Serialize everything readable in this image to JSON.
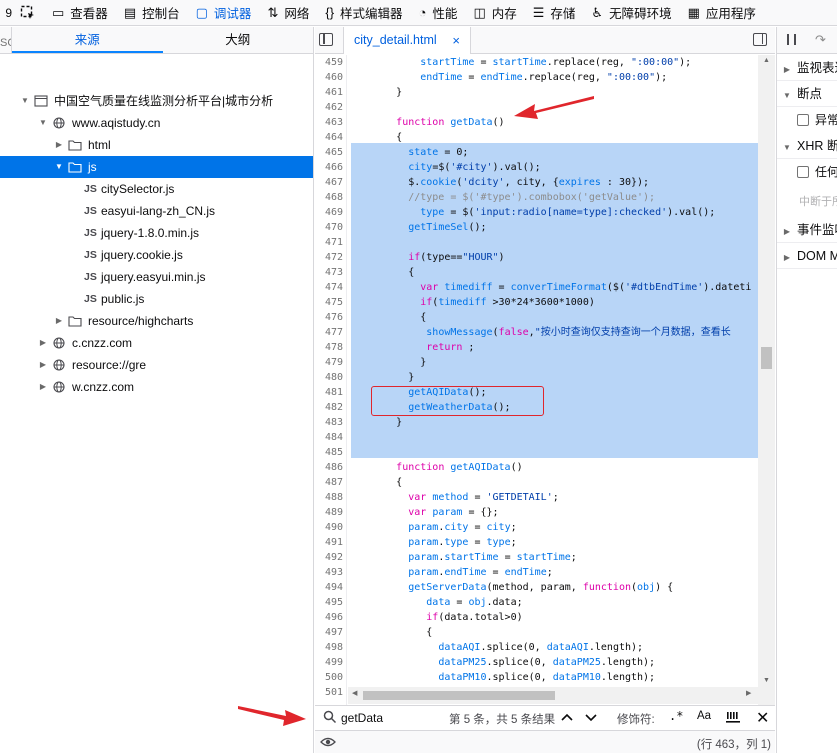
{
  "toolbar": {
    "stub": "9",
    "tabs": [
      {
        "label": "查看器",
        "icon": "inspector-icon"
      },
      {
        "label": "控制台",
        "icon": "console-icon"
      },
      {
        "label": "调试器",
        "icon": "debugger-icon",
        "active": true
      },
      {
        "label": "网络",
        "icon": "network-icon"
      },
      {
        "label": "样式编辑器",
        "icon": "style-editor-icon"
      },
      {
        "label": "性能",
        "icon": "performance-icon"
      },
      {
        "label": "内存",
        "icon": "memory-icon"
      },
      {
        "label": "存储",
        "icon": "storage-icon"
      },
      {
        "label": "无障碍环境",
        "icon": "accessibility-icon"
      },
      {
        "label": "应用程序",
        "icon": "application-icon"
      }
    ]
  },
  "sources": {
    "stub": "SC",
    "tab_sources": "来源",
    "tab_outline": "大纲",
    "tree": [
      {
        "label": "中国空气质量在线监测分析平台|城市分析",
        "kind": "page",
        "level": 0,
        "open": true
      },
      {
        "label": "www.aqistudy.cn",
        "kind": "globe",
        "level": 1,
        "open": true
      },
      {
        "label": "html",
        "kind": "folder",
        "level": 2,
        "open": false
      },
      {
        "label": "js",
        "kind": "folder",
        "level": 2,
        "open": true,
        "selected": true
      },
      {
        "label": "citySelector.js",
        "kind": "js",
        "level": 3
      },
      {
        "label": "easyui-lang-zh_CN.js",
        "kind": "js",
        "level": 3
      },
      {
        "label": "jquery-1.8.0.min.js",
        "kind": "js",
        "level": 3
      },
      {
        "label": "jquery.cookie.js",
        "kind": "js",
        "level": 3
      },
      {
        "label": "jquery.easyui.min.js",
        "kind": "js",
        "level": 3
      },
      {
        "label": "public.js",
        "kind": "js",
        "level": 3
      },
      {
        "label": "resource/highcharts",
        "kind": "folder",
        "level": 2,
        "open": false
      },
      {
        "label": "c.cnzz.com",
        "kind": "globe",
        "level": 1,
        "open": false
      },
      {
        "label": "resource://gre",
        "kind": "globe",
        "level": 1,
        "open": false
      },
      {
        "label": "w.cnzz.com",
        "kind": "globe",
        "level": 1,
        "open": false
      }
    ]
  },
  "editor": {
    "file_tab": "city_detail.html",
    "close_symbol": "×",
    "lines": [
      {
        "n": "459",
        "segs": [
          [
            "            ",
            ""
          ],
          [
            "startTime",
            "va"
          ],
          [
            " = ",
            ""
          ],
          [
            "startTime",
            "va"
          ],
          [
            ".replace(reg, ",
            ""
          ],
          [
            "\":00:00\"",
            "st"
          ],
          [
            ");",
            ""
          ]
        ]
      },
      {
        "n": "460",
        "segs": [
          [
            "            ",
            ""
          ],
          [
            "endTime",
            "va"
          ],
          [
            " = ",
            ""
          ],
          [
            "endTime",
            "va"
          ],
          [
            ".replace(reg, ",
            ""
          ],
          [
            "\":00:00\"",
            "st"
          ],
          [
            ");",
            ""
          ]
        ]
      },
      {
        "n": "461",
        "segs": [
          [
            "        }",
            ""
          ]
        ]
      },
      {
        "n": "462",
        "segs": []
      },
      {
        "n": "463",
        "segs": [
          [
            "        ",
            ""
          ],
          [
            "function",
            "kw"
          ],
          [
            " ",
            ""
          ],
          [
            "getData",
            "fn"
          ],
          [
            "()",
            ""
          ]
        ]
      },
      {
        "n": "464",
        "segs": [
          [
            "        {",
            ""
          ]
        ]
      },
      {
        "n": "465",
        "segs": [
          [
            "          ",
            ""
          ],
          [
            "state",
            "va"
          ],
          [
            " = 0;",
            ""
          ]
        ]
      },
      {
        "n": "466",
        "segs": [
          [
            "          ",
            ""
          ],
          [
            "city",
            "va"
          ],
          [
            "=$(",
            ""
          ],
          [
            "'#city'",
            "st"
          ],
          [
            ").val();",
            ""
          ]
        ]
      },
      {
        "n": "467",
        "segs": [
          [
            "          $.",
            ""
          ],
          [
            "cookie",
            "va"
          ],
          [
            "(",
            ""
          ],
          [
            "'dcity'",
            "st"
          ],
          [
            ", city, {",
            ""
          ],
          [
            "expires",
            "va"
          ],
          [
            " : 30});",
            ""
          ]
        ]
      },
      {
        "n": "468",
        "segs": [
          [
            "          //type = $('#type').combobox('getValue');",
            "cm"
          ]
        ]
      },
      {
        "n": "469",
        "segs": [
          [
            "            ",
            ""
          ],
          [
            "type",
            "va"
          ],
          [
            " = $(",
            ""
          ],
          [
            "'input:radio[name=type]:checked'",
            "st"
          ],
          [
            ").val();",
            ""
          ]
        ]
      },
      {
        "n": "470",
        "segs": [
          [
            "          ",
            ""
          ],
          [
            "getTimeSel",
            "va"
          ],
          [
            "();",
            ""
          ]
        ]
      },
      {
        "n": "471",
        "segs": []
      },
      {
        "n": "472",
        "segs": [
          [
            "          ",
            ""
          ],
          [
            "if",
            "kw"
          ],
          [
            "(type==",
            ""
          ],
          [
            "\"HOUR\"",
            "st"
          ],
          [
            ")",
            ""
          ]
        ]
      },
      {
        "n": "473",
        "segs": [
          [
            "          {",
            ""
          ]
        ]
      },
      {
        "n": "474",
        "segs": [
          [
            "            ",
            ""
          ],
          [
            "var",
            "kw"
          ],
          [
            " ",
            ""
          ],
          [
            "timediff",
            "va"
          ],
          [
            " = ",
            ""
          ],
          [
            "converTimeFormat",
            "va"
          ],
          [
            "($(",
            ""
          ],
          [
            "'#dtbEndTime'",
            "st"
          ],
          [
            ").dateti",
            ""
          ]
        ]
      },
      {
        "n": "475",
        "segs": [
          [
            "            ",
            ""
          ],
          [
            "if",
            "kw"
          ],
          [
            "(",
            ""
          ],
          [
            "timediff",
            "va"
          ],
          [
            " >30*24*3600*1000)",
            ""
          ]
        ]
      },
      {
        "n": "476",
        "segs": [
          [
            "            {",
            ""
          ]
        ]
      },
      {
        "n": "477",
        "segs": [
          [
            "             ",
            ""
          ],
          [
            "showMessage",
            "va"
          ],
          [
            "(",
            ""
          ],
          [
            "false",
            "kw"
          ],
          [
            ",",
            ""
          ],
          [
            "\"按小时查询仅支持查询一个月数据，查看长",
            "st"
          ]
        ]
      },
      {
        "n": "478",
        "segs": [
          [
            "             ",
            ""
          ],
          [
            "return",
            "kw"
          ],
          [
            " ;",
            ""
          ]
        ]
      },
      {
        "n": "479",
        "segs": [
          [
            "            }",
            ""
          ]
        ]
      },
      {
        "n": "480",
        "segs": [
          [
            "          }",
            ""
          ]
        ]
      },
      {
        "n": "481",
        "segs": [
          [
            "          ",
            ""
          ],
          [
            "getAQIData",
            "va"
          ],
          [
            "();",
            ""
          ]
        ]
      },
      {
        "n": "482",
        "segs": [
          [
            "          ",
            ""
          ],
          [
            "getWeatherData",
            "va"
          ],
          [
            "();",
            ""
          ]
        ]
      },
      {
        "n": "483",
        "segs": [
          [
            "        }",
            ""
          ]
        ]
      },
      {
        "n": "484",
        "segs": []
      },
      {
        "n": "485",
        "segs": []
      },
      {
        "n": "486",
        "segs": [
          [
            "        ",
            ""
          ],
          [
            "function",
            "kw"
          ],
          [
            " ",
            ""
          ],
          [
            "getAQIData",
            "va"
          ],
          [
            "()",
            ""
          ]
        ]
      },
      {
        "n": "487",
        "segs": [
          [
            "        {",
            ""
          ]
        ]
      },
      {
        "n": "488",
        "segs": [
          [
            "          ",
            ""
          ],
          [
            "var",
            "kw"
          ],
          [
            " ",
            ""
          ],
          [
            "method",
            "va"
          ],
          [
            " = ",
            ""
          ],
          [
            "'GETDETAIL'",
            "st"
          ],
          [
            ";",
            ""
          ]
        ]
      },
      {
        "n": "489",
        "segs": [
          [
            "          ",
            ""
          ],
          [
            "var",
            "kw"
          ],
          [
            " ",
            ""
          ],
          [
            "param",
            "va"
          ],
          [
            " = {};",
            ""
          ]
        ]
      },
      {
        "n": "490",
        "segs": [
          [
            "          ",
            ""
          ],
          [
            "param",
            "va"
          ],
          [
            ".",
            ""
          ],
          [
            "city",
            "va"
          ],
          [
            " = ",
            ""
          ],
          [
            "city",
            "va"
          ],
          [
            ";",
            ""
          ]
        ]
      },
      {
        "n": "491",
        "segs": [
          [
            "          ",
            ""
          ],
          [
            "param",
            "va"
          ],
          [
            ".",
            ""
          ],
          [
            "type",
            "va"
          ],
          [
            " = ",
            ""
          ],
          [
            "type",
            "va"
          ],
          [
            ";",
            ""
          ]
        ]
      },
      {
        "n": "492",
        "segs": [
          [
            "          ",
            ""
          ],
          [
            "param",
            "va"
          ],
          [
            ".",
            ""
          ],
          [
            "startTime",
            "va"
          ],
          [
            " = ",
            ""
          ],
          [
            "startTime",
            "va"
          ],
          [
            ";",
            ""
          ]
        ]
      },
      {
        "n": "493",
        "segs": [
          [
            "          ",
            ""
          ],
          [
            "param",
            "va"
          ],
          [
            ".",
            ""
          ],
          [
            "endTime",
            "va"
          ],
          [
            " = ",
            ""
          ],
          [
            "endTime",
            "va"
          ],
          [
            ";",
            ""
          ]
        ]
      },
      {
        "n": "494",
        "segs": [
          [
            "          ",
            ""
          ],
          [
            "getServerData",
            "va"
          ],
          [
            "(method, param, ",
            ""
          ],
          [
            "function",
            "kw"
          ],
          [
            "(",
            ""
          ],
          [
            "obj",
            "va"
          ],
          [
            ") {",
            ""
          ]
        ]
      },
      {
        "n": "495",
        "segs": [
          [
            "             ",
            ""
          ],
          [
            "data",
            "va"
          ],
          [
            " = ",
            ""
          ],
          [
            "obj",
            "va"
          ],
          [
            ".data;",
            ""
          ]
        ]
      },
      {
        "n": "496",
        "segs": [
          [
            "             ",
            ""
          ],
          [
            "if",
            "kw"
          ],
          [
            "(data.total>0)",
            ""
          ]
        ]
      },
      {
        "n": "497",
        "segs": [
          [
            "             {",
            ""
          ]
        ]
      },
      {
        "n": "498",
        "segs": [
          [
            "               ",
            ""
          ],
          [
            "dataAQI",
            "va"
          ],
          [
            ".splice(0, ",
            ""
          ],
          [
            "dataAQI",
            "va"
          ],
          [
            ".length);",
            ""
          ]
        ]
      },
      {
        "n": "499",
        "segs": [
          [
            "               ",
            ""
          ],
          [
            "dataPM25",
            "va"
          ],
          [
            ".splice(0, ",
            ""
          ],
          [
            "dataPM25",
            "va"
          ],
          [
            ".length);",
            ""
          ]
        ]
      },
      {
        "n": "500",
        "segs": [
          [
            "               ",
            ""
          ],
          [
            "dataPM10",
            "va"
          ],
          [
            ".splice(0, ",
            ""
          ],
          [
            "dataPM10",
            "va"
          ],
          [
            ".length);",
            ""
          ]
        ]
      },
      {
        "n": "501",
        "segs": []
      }
    ]
  },
  "search": {
    "query": "getData",
    "result_text": "第 5 条，共 5 条结果",
    "modifiers_label": "修饰符:",
    "regex_label": ".*",
    "case_label": "Aa"
  },
  "status": {
    "position": "(行 463，列 1)"
  },
  "right_panel": {
    "watch": "监视表达式",
    "breakpoints": "断点",
    "pause_exceptions": "异常时暂停",
    "xhr": "XHR 断点",
    "any_url": "任何 URL",
    "hint": "中断于所有",
    "events": "事件监听器断点",
    "dom": "DOM Mutation 断点"
  },
  "colors": {
    "accent": "#0060df",
    "selection": "#b8d5f7",
    "annotation": "#e0262c"
  }
}
